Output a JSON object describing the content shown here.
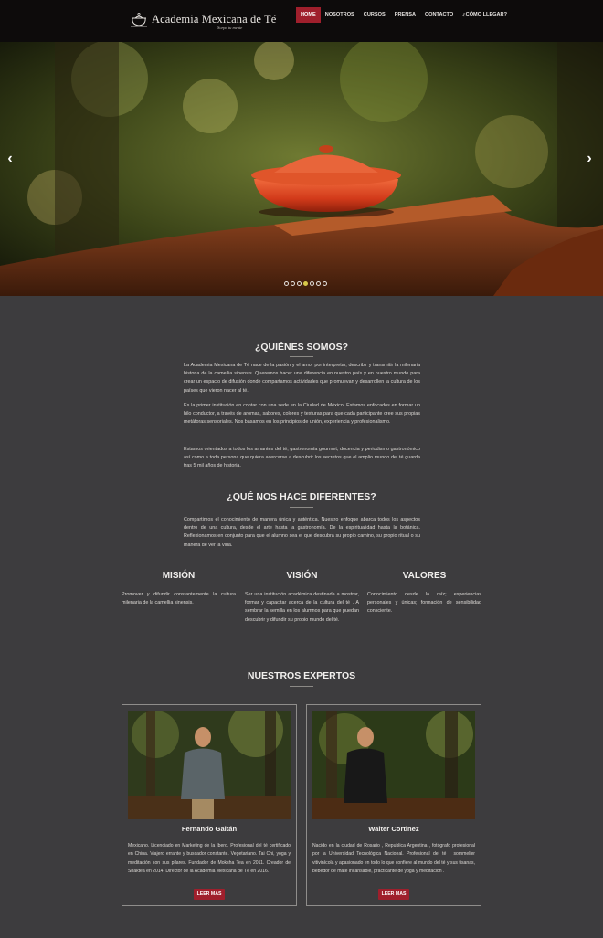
{
  "header": {
    "brand_name": "Academia Mexicana de Té",
    "brand_tagline": "Sorpa tu mente",
    "nav": [
      {
        "label": "HOME",
        "active": true
      },
      {
        "label": "NOSOTROS",
        "active": false
      },
      {
        "label": "CURSOS",
        "active": false
      },
      {
        "label": "PRENSA",
        "active": false
      },
      {
        "label": "CONTACTO",
        "active": false
      },
      {
        "label": "¿CÓMO LLEGAR?",
        "active": false
      }
    ]
  },
  "slider": {
    "prev_icon": "‹",
    "next_icon": "›",
    "slide_count": 7,
    "active_slide": 4
  },
  "quienes": {
    "title": "¿QUIÉNES SOMOS?",
    "paragraphs": [
      "La Academia Mexicana de Té nace de la pasión y el amor por interpretar, describir y transmitir la milenaria historia de la camellia sinensis. Queremos hacer una diferencia en nuestro país y en nuestro mundo para crear un espacio de difusión donde compartamos actividades que promuevan y desarrollen la cultura de los países que vieron nacer al té.",
      "Es la primer institución en contar con una sede en la Ciudad de México. Estamos enfocados en formar un hilo conductor, a través de aromas, sabores, colores y texturas para que cada participante cree sus propias metáforas sensoriales. Nos basamos en los principios de unión, experiencia y profesionalismo.",
      "Estamos orientados a todos los amantes del té, gastronomía gourmet, docencia y periodismo gastronómico así como a toda persona que quiera acercarse a descubrir los secretos que el amplio mundo del té guarda tras 5 mil años de historia."
    ]
  },
  "diferentes": {
    "title": "¿QUÉ NOS HACE DIFERENTES?",
    "paragraph": "Compartimos el conocimiento de manera única y auténtica. Nuestro enfoque abarca todos los aspectos dentro de una cultura, desde el arte hasta la gastronomía. De la espiritualidad hasta la botánica. Reflexionamos en conjunto para que el alumno sea el que descubra su propio camino, su propio ritual o su manera de ver la vida."
  },
  "columns": [
    {
      "title": "MISIÓN",
      "text": "Promover y difundir constantemente la cultura milenaria de la camellia sinensis."
    },
    {
      "title": "VISIÓN",
      "text": "Ser una institución académica destinada a mostrar, formar y capacitar acerca de la cultura del té . A sembrar la semilla en los alumnos para que puedan descubrir y difundir su propio mundo del té."
    },
    {
      "title": "VALORES",
      "text": "Conocimiento desde la raíz; experiencias personales y únicas; formación de sensibilidad consciente."
    }
  ],
  "experts": {
    "title": "NUESTROS EXPERTOS",
    "items": [
      {
        "name": "Fernando Gaitán",
        "bio": "Mexicano. Licenciado en Marketing de la Ibero. Profesional del té certificado en China. Viajero errante y buscador constante. Vegetariano. Tai Chi, yoga y meditación son sus pilares. Fundador de Moksha Tea en 2011. Creador de Shaktea en 2014. Director de la Academia Mexicana de Té en 2016.",
        "button": "LEER MÁS"
      },
      {
        "name": "Walter Cortinez",
        "bio": "Nacido en la ciudad de Rosario , Republica Argentina , fotógrafo profesional por la Universidad Tecnológica Nacional. Profesional del té , sommelier vitivinícola y apasionado en todo lo que confiere al mundo del té y sus tisanas, bebedor de mate incansable, practicante de yoga y meditación .",
        "button": "LEER MÁS"
      }
    ]
  },
  "colors": {
    "accent": "#9f1f2c",
    "background": "#3d3c3e",
    "header": "#0d0b0b",
    "teapot": "#d8401f"
  },
  "icons": {
    "logo": "teapot-logo-icon",
    "prev": "chevron-left-icon",
    "next": "chevron-right-icon"
  }
}
